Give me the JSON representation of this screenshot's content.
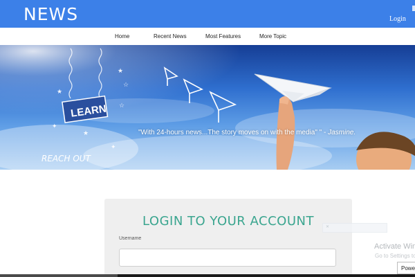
{
  "header": {
    "brand": "NEWS",
    "login_label": "Login"
  },
  "nav": {
    "items": [
      {
        "label": "Home"
      },
      {
        "label": "Recent News"
      },
      {
        "label": "Most Features"
      },
      {
        "label": "More Topic"
      }
    ]
  },
  "hero": {
    "quote_text": "\"With 24-hours news...The story moves on with the media\" \" - ",
    "quote_author": "Jasmine.",
    "sign_text": "LEARN",
    "reach_text": "REACH OUT"
  },
  "login_card": {
    "title": "LOGIN TO YOUR ACCOUNT",
    "username_label": "Username",
    "username_value": ""
  },
  "watermark": {
    "title": "Activate Win",
    "subtitle": "Go to Settings to"
  },
  "power_button": {
    "label": "Power"
  },
  "colors": {
    "topbar": "#3c80e8",
    "accent_teal": "#3aa58f",
    "card_bg": "#efefef"
  }
}
